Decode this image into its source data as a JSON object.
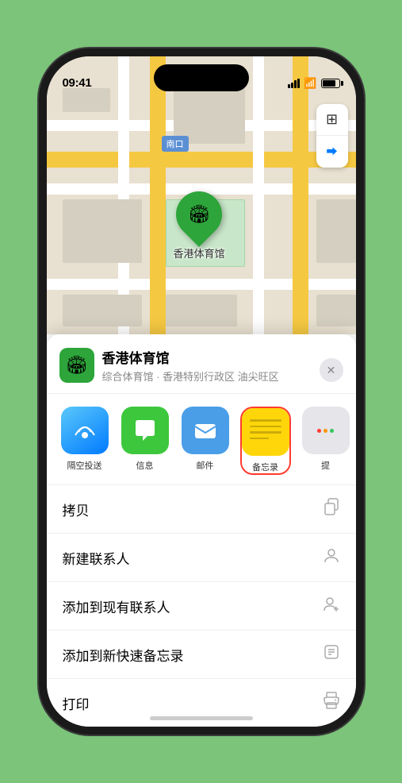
{
  "status": {
    "time": "09:41",
    "location_arrow": "▲"
  },
  "map": {
    "location_label": "南口",
    "pin_label": "香港体育馆",
    "controls": {
      "map_icon": "⊞",
      "location_icon": "◎"
    }
  },
  "sheet": {
    "venue_icon": "🏟",
    "venue_name": "香港体育馆",
    "venue_sub": "综合体育馆 · 香港特别行政区 油尖旺区",
    "close_label": "✕"
  },
  "share_items": [
    {
      "id": "airdrop",
      "label": "隔空投送",
      "type": "airdrop"
    },
    {
      "id": "messages",
      "label": "信息",
      "type": "messages"
    },
    {
      "id": "mail",
      "label": "邮件",
      "type": "mail"
    },
    {
      "id": "notes",
      "label": "备忘录",
      "type": "notes",
      "selected": true
    },
    {
      "id": "more",
      "label": "提",
      "type": "more"
    }
  ],
  "actions": [
    {
      "id": "copy",
      "text": "拷贝",
      "icon": "copy"
    },
    {
      "id": "new-contact",
      "text": "新建联系人",
      "icon": "person"
    },
    {
      "id": "add-existing",
      "text": "添加到现有联系人",
      "icon": "person-add"
    },
    {
      "id": "add-notes",
      "text": "添加到新快速备忘录",
      "icon": "notes"
    },
    {
      "id": "print",
      "text": "打印",
      "icon": "printer"
    }
  ]
}
